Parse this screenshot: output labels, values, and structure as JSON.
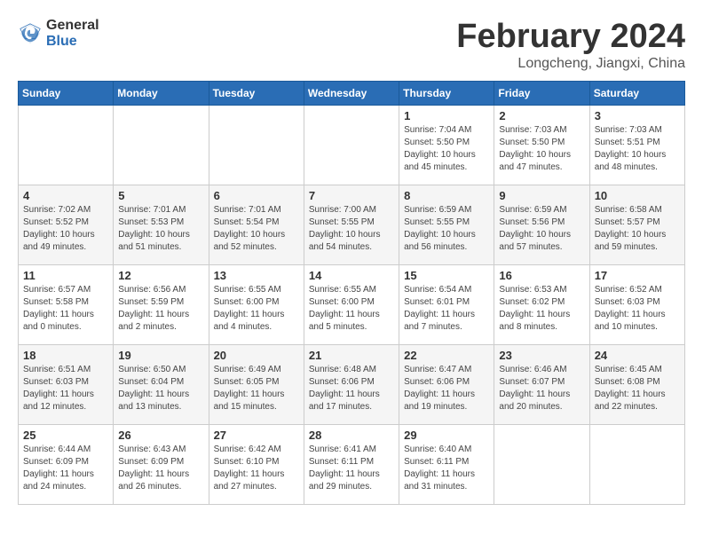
{
  "header": {
    "logo_general": "General",
    "logo_blue": "Blue",
    "month_title": "February 2024",
    "location": "Longcheng, Jiangxi, China"
  },
  "weekdays": [
    "Sunday",
    "Monday",
    "Tuesday",
    "Wednesday",
    "Thursday",
    "Friday",
    "Saturday"
  ],
  "weeks": [
    [
      {
        "day": "",
        "info": ""
      },
      {
        "day": "",
        "info": ""
      },
      {
        "day": "",
        "info": ""
      },
      {
        "day": "",
        "info": ""
      },
      {
        "day": "1",
        "info": "Sunrise: 7:04 AM\nSunset: 5:50 PM\nDaylight: 10 hours\nand 45 minutes."
      },
      {
        "day": "2",
        "info": "Sunrise: 7:03 AM\nSunset: 5:50 PM\nDaylight: 10 hours\nand 47 minutes."
      },
      {
        "day": "3",
        "info": "Sunrise: 7:03 AM\nSunset: 5:51 PM\nDaylight: 10 hours\nand 48 minutes."
      }
    ],
    [
      {
        "day": "4",
        "info": "Sunrise: 7:02 AM\nSunset: 5:52 PM\nDaylight: 10 hours\nand 49 minutes."
      },
      {
        "day": "5",
        "info": "Sunrise: 7:01 AM\nSunset: 5:53 PM\nDaylight: 10 hours\nand 51 minutes."
      },
      {
        "day": "6",
        "info": "Sunrise: 7:01 AM\nSunset: 5:54 PM\nDaylight: 10 hours\nand 52 minutes."
      },
      {
        "day": "7",
        "info": "Sunrise: 7:00 AM\nSunset: 5:55 PM\nDaylight: 10 hours\nand 54 minutes."
      },
      {
        "day": "8",
        "info": "Sunrise: 6:59 AM\nSunset: 5:55 PM\nDaylight: 10 hours\nand 56 minutes."
      },
      {
        "day": "9",
        "info": "Sunrise: 6:59 AM\nSunset: 5:56 PM\nDaylight: 10 hours\nand 57 minutes."
      },
      {
        "day": "10",
        "info": "Sunrise: 6:58 AM\nSunset: 5:57 PM\nDaylight: 10 hours\nand 59 minutes."
      }
    ],
    [
      {
        "day": "11",
        "info": "Sunrise: 6:57 AM\nSunset: 5:58 PM\nDaylight: 11 hours\nand 0 minutes."
      },
      {
        "day": "12",
        "info": "Sunrise: 6:56 AM\nSunset: 5:59 PM\nDaylight: 11 hours\nand 2 minutes."
      },
      {
        "day": "13",
        "info": "Sunrise: 6:55 AM\nSunset: 6:00 PM\nDaylight: 11 hours\nand 4 minutes."
      },
      {
        "day": "14",
        "info": "Sunrise: 6:55 AM\nSunset: 6:00 PM\nDaylight: 11 hours\nand 5 minutes."
      },
      {
        "day": "15",
        "info": "Sunrise: 6:54 AM\nSunset: 6:01 PM\nDaylight: 11 hours\nand 7 minutes."
      },
      {
        "day": "16",
        "info": "Sunrise: 6:53 AM\nSunset: 6:02 PM\nDaylight: 11 hours\nand 8 minutes."
      },
      {
        "day": "17",
        "info": "Sunrise: 6:52 AM\nSunset: 6:03 PM\nDaylight: 11 hours\nand 10 minutes."
      }
    ],
    [
      {
        "day": "18",
        "info": "Sunrise: 6:51 AM\nSunset: 6:03 PM\nDaylight: 11 hours\nand 12 minutes."
      },
      {
        "day": "19",
        "info": "Sunrise: 6:50 AM\nSunset: 6:04 PM\nDaylight: 11 hours\nand 13 minutes."
      },
      {
        "day": "20",
        "info": "Sunrise: 6:49 AM\nSunset: 6:05 PM\nDaylight: 11 hours\nand 15 minutes."
      },
      {
        "day": "21",
        "info": "Sunrise: 6:48 AM\nSunset: 6:06 PM\nDaylight: 11 hours\nand 17 minutes."
      },
      {
        "day": "22",
        "info": "Sunrise: 6:47 AM\nSunset: 6:06 PM\nDaylight: 11 hours\nand 19 minutes."
      },
      {
        "day": "23",
        "info": "Sunrise: 6:46 AM\nSunset: 6:07 PM\nDaylight: 11 hours\nand 20 minutes."
      },
      {
        "day": "24",
        "info": "Sunrise: 6:45 AM\nSunset: 6:08 PM\nDaylight: 11 hours\nand 22 minutes."
      }
    ],
    [
      {
        "day": "25",
        "info": "Sunrise: 6:44 AM\nSunset: 6:09 PM\nDaylight: 11 hours\nand 24 minutes."
      },
      {
        "day": "26",
        "info": "Sunrise: 6:43 AM\nSunset: 6:09 PM\nDaylight: 11 hours\nand 26 minutes."
      },
      {
        "day": "27",
        "info": "Sunrise: 6:42 AM\nSunset: 6:10 PM\nDaylight: 11 hours\nand 27 minutes."
      },
      {
        "day": "28",
        "info": "Sunrise: 6:41 AM\nSunset: 6:11 PM\nDaylight: 11 hours\nand 29 minutes."
      },
      {
        "day": "29",
        "info": "Sunrise: 6:40 AM\nSunset: 6:11 PM\nDaylight: 11 hours\nand 31 minutes."
      },
      {
        "day": "",
        "info": ""
      },
      {
        "day": "",
        "info": ""
      }
    ]
  ]
}
